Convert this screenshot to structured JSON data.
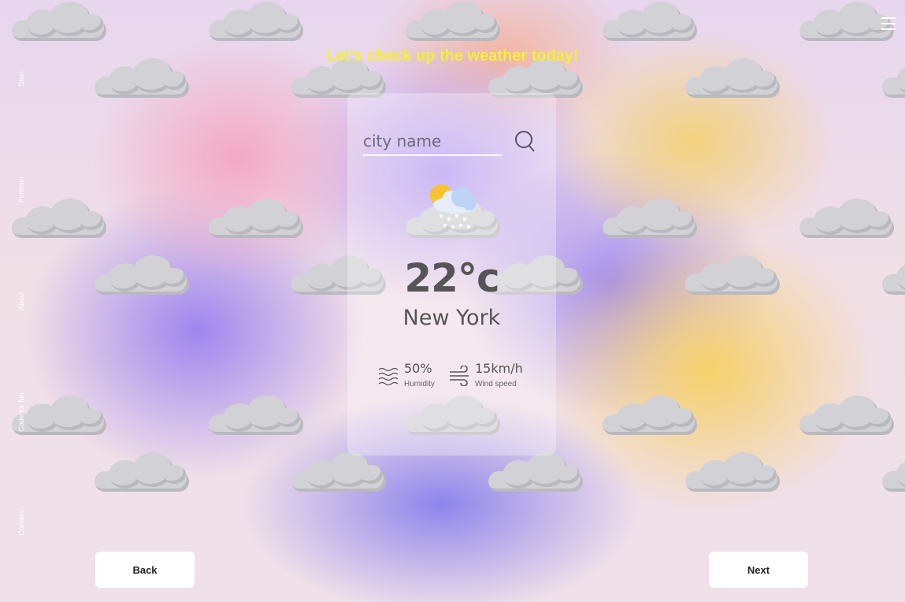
{
  "side_nav": {
    "items": [
      {
        "label": "Start"
      },
      {
        "label": "Portfolio"
      },
      {
        "label": "About"
      },
      {
        "label": "Code for fun"
      },
      {
        "label": "Contact"
      }
    ]
  },
  "menu": {
    "icon": "hamburger-menu-icon"
  },
  "headline": "Let's check up the weather today!",
  "search": {
    "placeholder": "city name",
    "value": "",
    "icon": "search-icon"
  },
  "weather": {
    "icon": "partly-cloudy-snow-icon",
    "temperature": "22°c",
    "city": "New York",
    "humidity": {
      "value": "50%",
      "label": "Humidity",
      "icon": "humidity-waves-icon"
    },
    "wind": {
      "value": "15km/h",
      "label": "Wind speed",
      "icon": "wind-icon"
    }
  },
  "buttons": {
    "back": "Back",
    "next": "Next"
  },
  "colors": {
    "headline": "#f4ef38",
    "text": "#555555",
    "button_bg": "#ffffff"
  }
}
